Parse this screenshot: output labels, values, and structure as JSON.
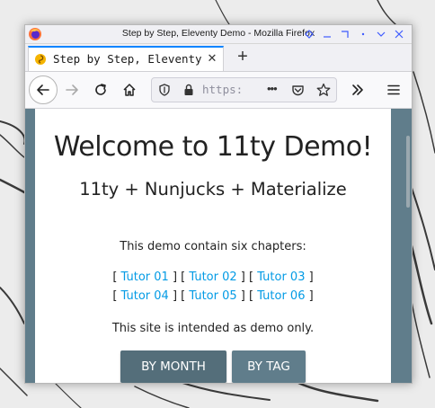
{
  "window": {
    "title": "Step by Step, Eleventy Demo - Mozilla Firefox"
  },
  "tabs": [
    {
      "label": "Step by Step, Eleventy Demo",
      "active": true
    }
  ],
  "navbar": {
    "url_display": "https:",
    "more_label": "•••"
  },
  "page": {
    "heading": "Welcome to 11ty Demo!",
    "subheading": "11ty + Nunjucks + Materialize",
    "intro": "This demo contain six chapters:",
    "tutors": [
      "Tutor 01",
      "Tutor 02",
      "Tutor 03",
      "Tutor 04",
      "Tutor 05",
      "Tutor 06"
    ],
    "notice": "This site is intended as demo only.",
    "buttons": {
      "by_month": "BY MONTH",
      "by_tag": "BY TAG"
    }
  },
  "colors": {
    "page_bg": "#607d8b",
    "button_dark": "#546e7a",
    "link": "#039be5",
    "tab_accent": "#0a84ff"
  },
  "icons": {
    "back": "back-arrow-icon",
    "forward": "forward-arrow-icon",
    "reload": "reload-icon",
    "home": "home-icon",
    "shield": "shield-icon",
    "lock": "lock-icon",
    "pocket": "pocket-icon",
    "bookmark": "star-icon",
    "overflow": "double-chevron-icon",
    "menu": "hamburger-icon"
  }
}
